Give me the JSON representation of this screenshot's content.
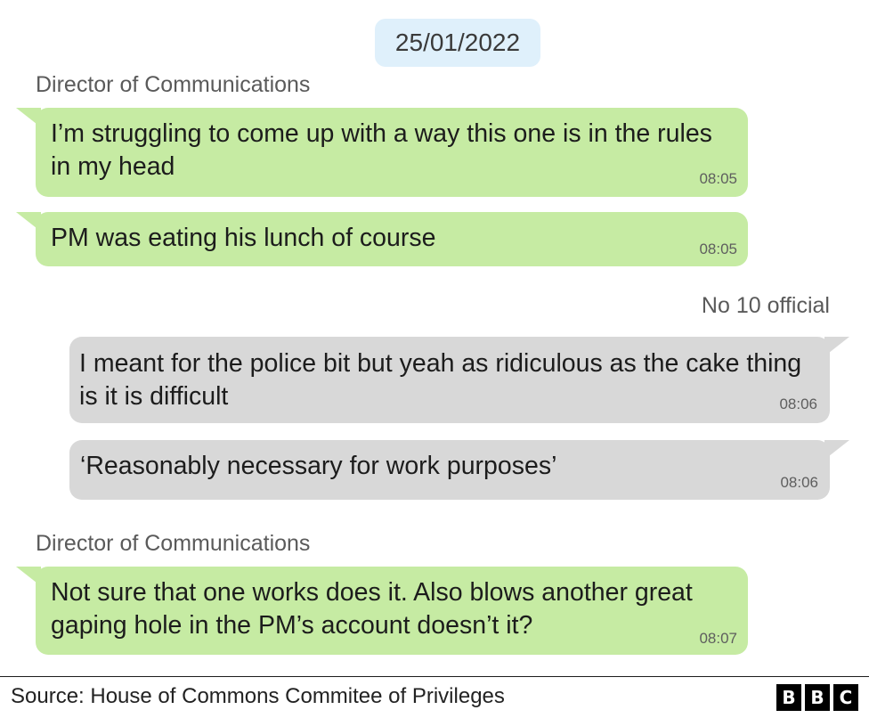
{
  "date": "25/01/2022",
  "senders": {
    "first": "Director of Communications",
    "second": "No 10 official",
    "third": "Director of Communications"
  },
  "messages": [
    {
      "text": "I’m struggling to come up with a way this one is in the rules in my head",
      "time": "08:05"
    },
    {
      "text": "PM was eating his lunch of course",
      "time": "08:05"
    },
    {
      "text": "I meant for the police bit but yeah as ridiculous as the cake thing is it is difficult",
      "time": "08:06"
    },
    {
      "text": "‘Reasonably necessary for work purposes’",
      "time": "08:06"
    },
    {
      "text": "Not sure that one works does it. Also blows another great gaping hole in the PM’s account doesn’t it?",
      "time": "08:07"
    }
  ],
  "footer": {
    "source": "Source: House of Commons Commitee of Privileges",
    "logo_letters": [
      "B",
      "B",
      "C"
    ]
  },
  "colors": {
    "outgoing_bubble": "#c6eba3",
    "incoming_bubble": "#d8d8d8",
    "date_pill": "#dff0fb"
  }
}
